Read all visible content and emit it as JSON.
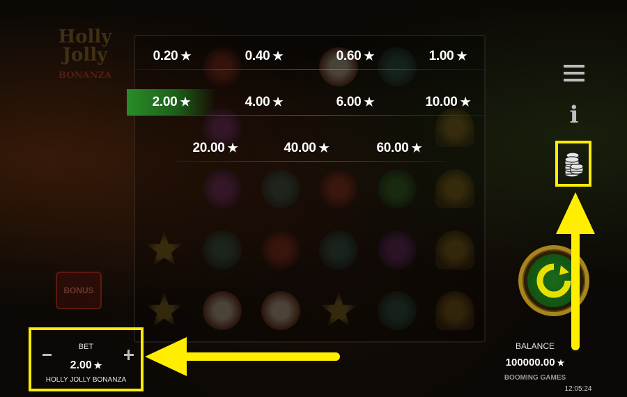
{
  "background": {
    "logo_line1": "Holly",
    "logo_line2": "Jolly",
    "logo_sub": "BONANZA",
    "bonus_label": "BONUS"
  },
  "bet_options": [
    {
      "value": "0.20",
      "selected": false
    },
    {
      "value": "0.40",
      "selected": false
    },
    {
      "value": "0.60",
      "selected": false
    },
    {
      "value": "1.00",
      "selected": false
    },
    {
      "value": "2.00",
      "selected": true
    },
    {
      "value": "4.00",
      "selected": false
    },
    {
      "value": "6.00",
      "selected": false
    },
    {
      "value": "10.00",
      "selected": false
    },
    {
      "value": "20.00",
      "selected": false
    },
    {
      "value": "40.00",
      "selected": false
    },
    {
      "value": "60.00",
      "selected": false
    }
  ],
  "currency_symbol": "★",
  "side_icons": {
    "menu": "hamburger-menu-icon",
    "info": "i",
    "bet_settings": "coin-stack-icon"
  },
  "bet_panel": {
    "label": "BET",
    "value": "2.00",
    "game_name": "HOLLY JOLLY BONANZA"
  },
  "balance": {
    "label": "BALANCE",
    "value": "100000.00"
  },
  "brand": "BOOMING GAMES",
  "clock": "12:05:24",
  "colors": {
    "highlight": "#ffee00",
    "selected_bet": "#2a8c2a",
    "spin_green": "#1a6a1a",
    "spin_gold": "#a8841c"
  }
}
